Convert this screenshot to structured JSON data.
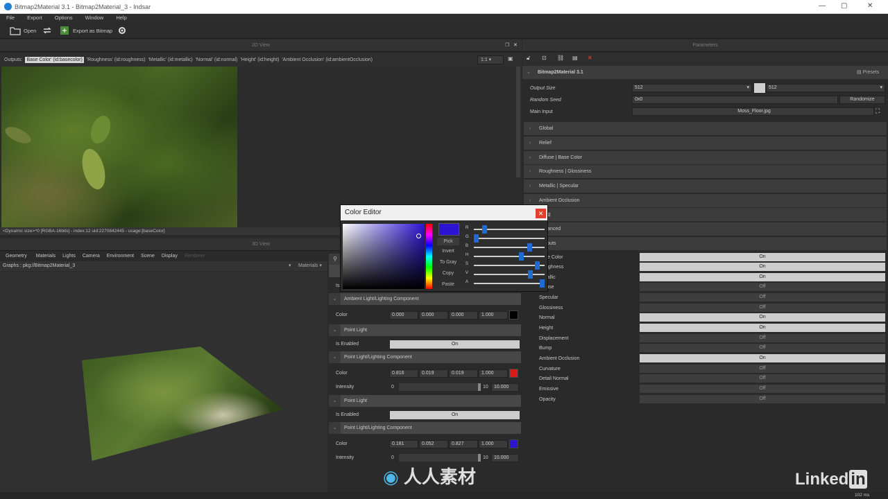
{
  "window": {
    "title": "Bitmap2Material 3.1 - Bitmap2Material_3 - Indsar",
    "min": "—",
    "max": "▢",
    "close": "✕"
  },
  "menu": [
    "File",
    "Export",
    "Options",
    "Window",
    "Help"
  ],
  "toolbar": {
    "open": "Open",
    "export": "Export as Bitmap"
  },
  "view2d": {
    "title": "2D View",
    "outputs_label": "Outputs:",
    "outputs": [
      "Base Color' (id:basecolor)",
      "'Roughness' (id:roughness)",
      "'Metallic' (id:metallic)",
      "'Normal' (id:normal)",
      "'Height' (id:height)",
      "'Ambient Occlusion' (id:ambientOcclusion)"
    ],
    "zoom": "1:1",
    "status": "<Dynamic size>^0 [RGBA-16bits] - index:12 uid:2270842445 - usage:[baseColor]"
  },
  "view3d": {
    "title": "3D View",
    "tabs": [
      "Geometry",
      "Materials",
      "Lights",
      "Camera",
      "Environment",
      "Scene",
      "Display",
      "Renderer"
    ],
    "graphs_label": "Graphs :",
    "graphs_value": "pkg://Bitmap2Material_3",
    "materials": "Materials"
  },
  "lights": {
    "is_label": "Is",
    "ambient": {
      "header": "Ambient Light/Lighting Component",
      "color_label": "Color",
      "values": [
        "0.000",
        "0.000",
        "0.000",
        "1.000"
      ],
      "swatch": "#000000"
    },
    "point1": {
      "header": "Point Light",
      "enabled_label": "Is Enabled",
      "enabled": "On"
    },
    "point1comp": {
      "header": "Point Light/Lighting Component",
      "color_label": "Color",
      "values": [
        "0.816",
        "0.019",
        "0.019",
        "1.000"
      ],
      "swatch": "#d81a1a",
      "intensity_label": "Intensity",
      "int_min": "0",
      "int_max": "10",
      "int_value": "10.000"
    },
    "point2": {
      "header": "Point Light",
      "enabled_label": "Is Enabled",
      "enabled": "On"
    },
    "point2comp": {
      "header": "Point Light/Lighting Component",
      "color_label": "Color",
      "values": [
        "0.181",
        "0.052",
        "0.827",
        "1.000"
      ],
      "swatch": "#2d14d3",
      "intensity_label": "Intensity",
      "int_min": "0",
      "int_max": "10",
      "int_value": "10.000"
    }
  },
  "color_editor": {
    "title": "Color Editor",
    "buttons": [
      "Pick",
      "Invert",
      "To Gray",
      "Copy",
      "Paste"
    ],
    "channels": [
      "R",
      "G",
      "B",
      "H",
      "S",
      "V",
      "A"
    ],
    "current": "#2d14d3"
  },
  "params": {
    "title": "Parameters",
    "presets": "Presets",
    "node": "Bitmap2Material 3.1",
    "output_size_label": "Output Size",
    "output_size_a": "512",
    "output_size_b": "512",
    "seed_label": "Random Seed",
    "seed_value": "0x0",
    "randomize": "Randomize",
    "input_label": "Main Input",
    "input_value": "Moss_Floor.jpg",
    "sections": [
      "Global",
      "Relief",
      "Diffuse | Base Color",
      "Roughness | Glossiness",
      "Metallic | Specular",
      "Ambient Occlusion",
      "Tiling",
      "Advanced",
      "Outputs"
    ],
    "outputs": [
      {
        "label": "Base Color",
        "state": "On"
      },
      {
        "label": "Roughness",
        "state": "On"
      },
      {
        "label": "Metallic",
        "state": "On"
      },
      {
        "label": "Diffuse",
        "state": "Off"
      },
      {
        "label": "Specular",
        "state": "Off"
      },
      {
        "label": "Glossiness",
        "state": "Off"
      },
      {
        "label": "Normal",
        "state": "On"
      },
      {
        "label": "Height",
        "state": "On"
      },
      {
        "label": "Displacement",
        "state": "Off"
      },
      {
        "label": "Bump",
        "state": "Off"
      },
      {
        "label": "Ambient Occlusion",
        "state": "On"
      },
      {
        "label": "Curvature",
        "state": "Off"
      },
      {
        "label": "Detail Normal",
        "state": "Off"
      },
      {
        "label": "Emissive",
        "state": "Off"
      },
      {
        "label": "Opacity",
        "state": "Off"
      }
    ]
  },
  "statusbar": {
    "time": "102 ms"
  },
  "watermark": {
    "brand": "Linked",
    "brand_in": "in",
    "site": "人人素材"
  }
}
